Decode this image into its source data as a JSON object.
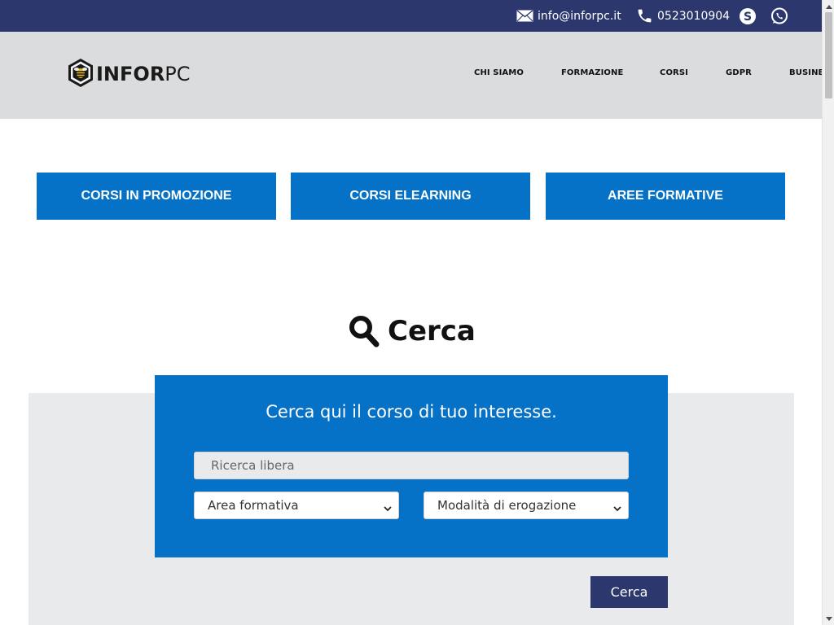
{
  "topbar": {
    "email": "info@inforpc.it",
    "phone": "0523010904",
    "icons": [
      "envelope-icon",
      "phone-icon",
      "skype-icon",
      "whatsapp-icon"
    ]
  },
  "header": {
    "logo_bold": "INFOR",
    "logo_light": "PC",
    "nav": [
      "CHI SIAMO",
      "FORMAZIONE",
      "CORSI",
      "GDPR",
      "BUSINE"
    ]
  },
  "quick_links": [
    "CORSI IN PROMOZIONE",
    "CORSI ELEARNING",
    "AREE FORMATIVE"
  ],
  "search": {
    "heading": "Cerca",
    "box_title": "Cerca qui il corso di tuo interesse.",
    "input_placeholder": "Ricerca libera",
    "select_area": "Area formativa",
    "select_modalita": "Modalità di erogazione",
    "submit_label": "Cerca"
  },
  "colors": {
    "topbar": "#2b376d",
    "header": "#dbdcde",
    "primary_blue": "#0572c7",
    "grey_section": "#e8eaeb",
    "submit": "#2b376d"
  }
}
